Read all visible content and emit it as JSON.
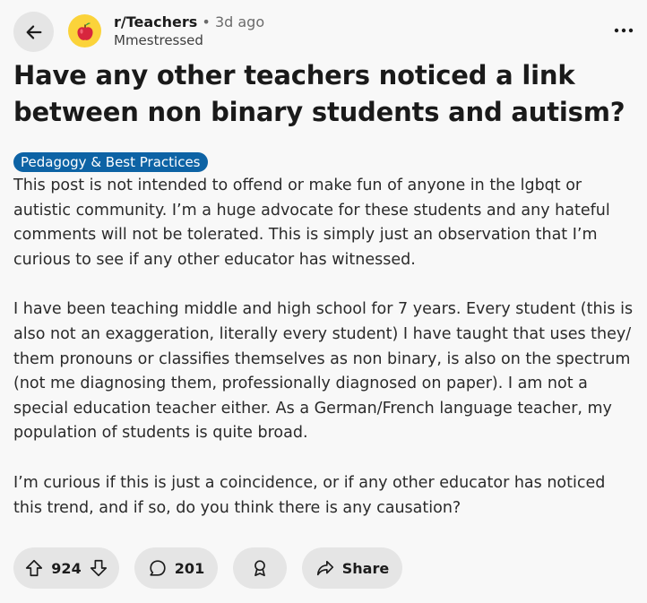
{
  "post": {
    "subreddit": "r/Teachers",
    "separator": "•",
    "age": "3d ago",
    "author": "Mmestressed",
    "title": "Have any other teachers noticed a link between non binary students and autism?",
    "flair": "Pedagogy & Best Practices",
    "paragraphs": [
      "This post is not intended to offend or make fun of anyone in the lgbqt or autistic community. I’m a huge advocate for these students and any hateful comments will not be tolerated. This is simply just an observation that I’m curious to see if any other educator has witnessed.",
      "I have been teaching middle and high school for 7 years. Every student (this is also not an exaggeration, literally every student) I have taught that uses they/ them pronouns or classifies themselves as non binary, is also on the spectrum (not me diagnosing them, professionally diagnosed on paper). I am not a special education teacher either. As a German/French language teacher, my population of students is quite broad.",
      "I’m curious if this is just a coincidence, or if any other educator has noticed this trend, and if so, do you think there is any causation?"
    ]
  },
  "actions": {
    "upvotes": "924",
    "comments": "201",
    "share_label": "Share"
  },
  "icons": {
    "back": "arrow-left-icon",
    "avatar": "apple-icon",
    "more": "more-horizontal-icon",
    "upvote": "arrow-up-icon",
    "downvote": "arrow-down-icon",
    "comment": "comment-bubble-icon",
    "award": "award-icon",
    "share": "share-arrow-icon"
  },
  "colors": {
    "background": "#f8f8f8",
    "pill": "#e5e5e5",
    "flair": "#0d63a5",
    "avatar_bg": "#fbd33a",
    "apple": "#d7263d"
  }
}
